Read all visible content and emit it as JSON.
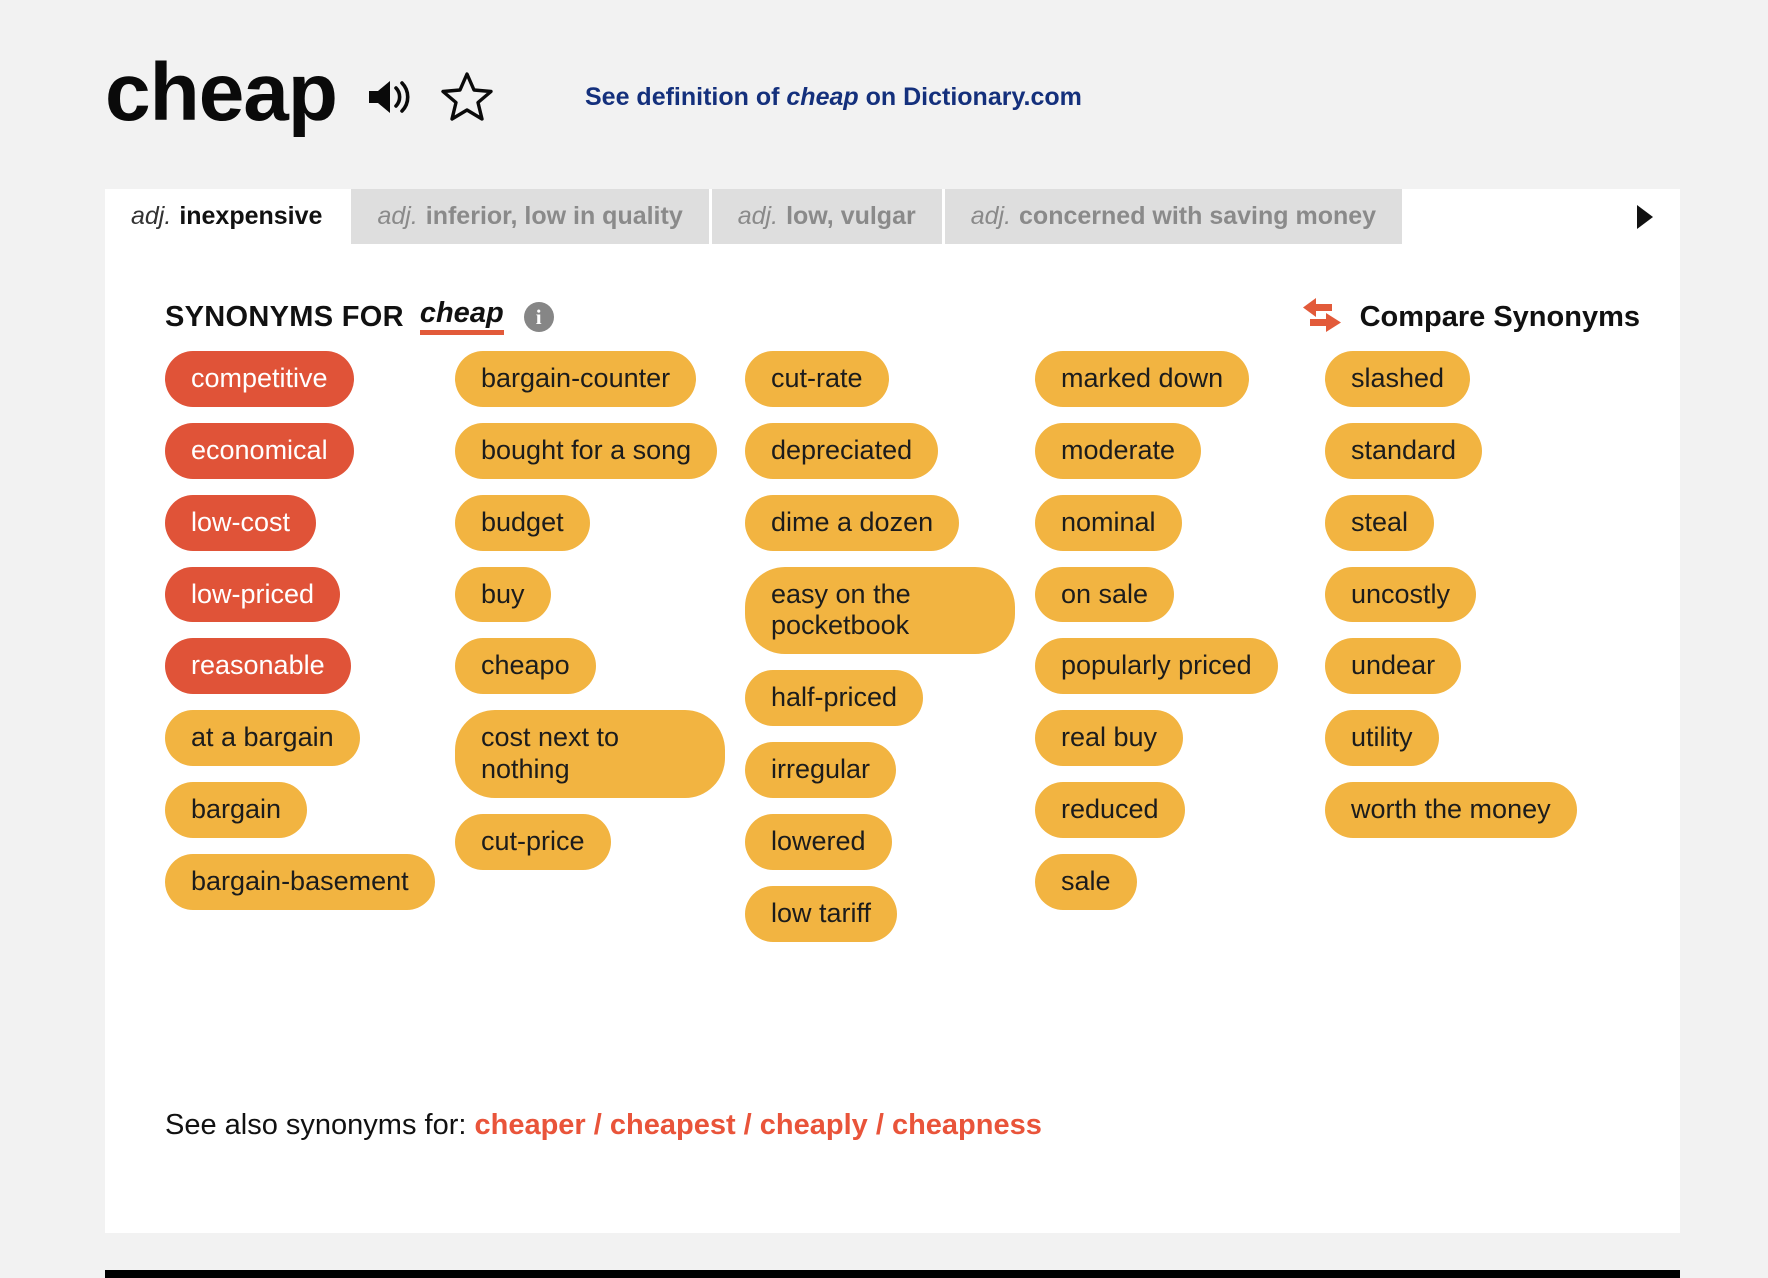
{
  "header": {
    "word": "cheap",
    "speaker_icon": "speaker-audio-icon",
    "star_icon": "star-favorite-icon",
    "definition_link_pre": "See definition of ",
    "definition_link_word": "cheap",
    "definition_link_post": " on Dictionary.com"
  },
  "tabs": {
    "next_icon": "chevron-right-icon",
    "items": [
      {
        "pos": "adj.",
        "label": "inexpensive",
        "active": true
      },
      {
        "pos": "adj.",
        "label": "inferior, low in quality",
        "active": false
      },
      {
        "pos": "adj.",
        "label": "low, vulgar",
        "active": false
      },
      {
        "pos": "adj.",
        "label": "concerned with saving money",
        "active": false
      }
    ]
  },
  "synonyms_header": {
    "label": "SYNONYMS FOR",
    "word": "cheap",
    "info_icon": "info-icon",
    "info_glyph": "i",
    "compare_icon": "compare-arrows-icon",
    "compare_label": "Compare Synonyms"
  },
  "colors": {
    "strong_match": "#e05338",
    "normal_match": "#f2b441",
    "accent_underline": "#e25a3a",
    "link_navy": "#14307c",
    "link_red": "#e9543a"
  },
  "chips": {
    "columns": [
      [
        {
          "text": "competitive",
          "strength": "strong"
        },
        {
          "text": "economical",
          "strength": "strong"
        },
        {
          "text": "low-cost",
          "strength": "strong"
        },
        {
          "text": "low-priced",
          "strength": "strong"
        },
        {
          "text": "reasonable",
          "strength": "strong"
        },
        {
          "text": "at a bargain",
          "strength": "normal"
        },
        {
          "text": "bargain",
          "strength": "normal"
        },
        {
          "text": "bargain-basement",
          "strength": "normal"
        }
      ],
      [
        {
          "text": "bargain-counter",
          "strength": "normal"
        },
        {
          "text": "bought for a song",
          "strength": "normal"
        },
        {
          "text": "budget",
          "strength": "normal"
        },
        {
          "text": "buy",
          "strength": "normal"
        },
        {
          "text": "cheapo",
          "strength": "normal"
        },
        {
          "text": "cost next to nothing",
          "strength": "normal"
        },
        {
          "text": "cut-price",
          "strength": "normal"
        }
      ],
      [
        {
          "text": "cut-rate",
          "strength": "normal"
        },
        {
          "text": "depreciated",
          "strength": "normal"
        },
        {
          "text": "dime a dozen",
          "strength": "normal"
        },
        {
          "text": "easy on the pocketbook",
          "strength": "normal"
        },
        {
          "text": "half-priced",
          "strength": "normal"
        },
        {
          "text": "irregular",
          "strength": "normal"
        },
        {
          "text": "lowered",
          "strength": "normal"
        },
        {
          "text": "low tariff",
          "strength": "normal"
        }
      ],
      [
        {
          "text": "marked down",
          "strength": "normal"
        },
        {
          "text": "moderate",
          "strength": "normal"
        },
        {
          "text": "nominal",
          "strength": "normal"
        },
        {
          "text": "on sale",
          "strength": "normal"
        },
        {
          "text": "popularly priced",
          "strength": "normal"
        },
        {
          "text": "real buy",
          "strength": "normal"
        },
        {
          "text": "reduced",
          "strength": "normal"
        },
        {
          "text": "sale",
          "strength": "normal"
        }
      ],
      [
        {
          "text": "slashed",
          "strength": "normal"
        },
        {
          "text": "standard",
          "strength": "normal"
        },
        {
          "text": "steal",
          "strength": "normal"
        },
        {
          "text": "uncostly",
          "strength": "normal"
        },
        {
          "text": "undear",
          "strength": "normal"
        },
        {
          "text": "utility",
          "strength": "normal"
        },
        {
          "text": "worth the money",
          "strength": "normal"
        }
      ]
    ]
  },
  "see_also": {
    "prefix": "See also synonyms for: ",
    "links": "cheaper / cheapest / cheaply / cheapness"
  }
}
